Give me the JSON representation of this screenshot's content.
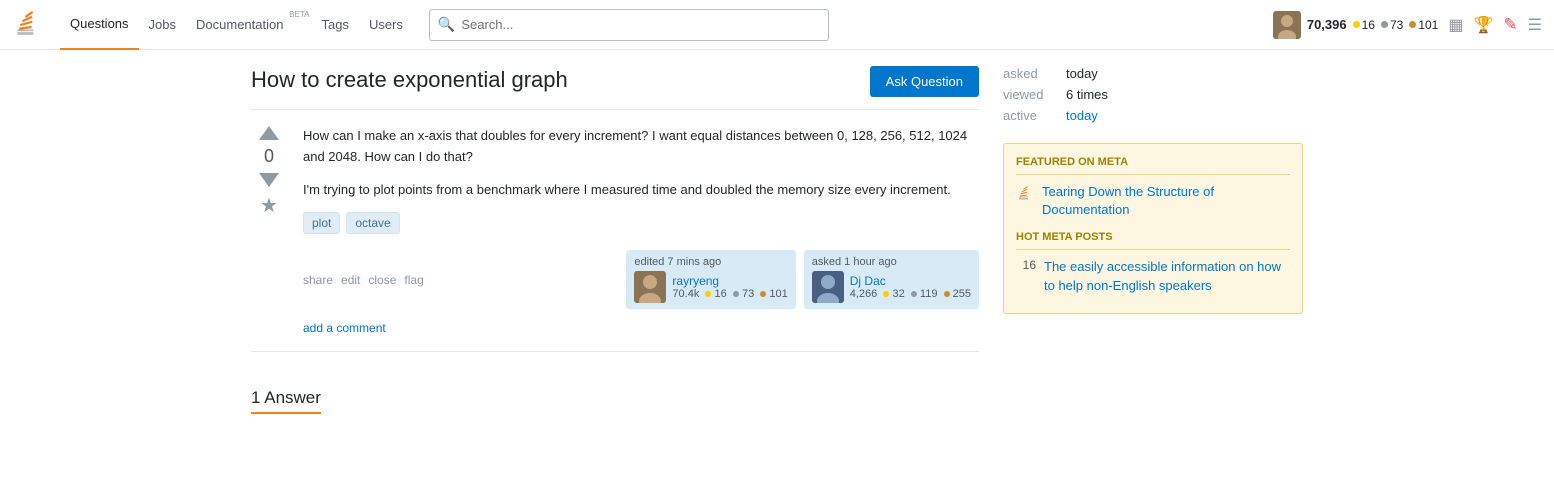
{
  "header": {
    "nav_items": [
      {
        "label": "Questions",
        "active": true,
        "beta": false
      },
      {
        "label": "Jobs",
        "active": false,
        "beta": false
      },
      {
        "label": "Documentation",
        "active": false,
        "beta": true
      },
      {
        "label": "Tags",
        "active": false,
        "beta": false
      },
      {
        "label": "Users",
        "active": false,
        "beta": false
      }
    ],
    "search_placeholder": "Search...",
    "user_rep": "70,396",
    "badge_gold": "16",
    "badge_silver": "73",
    "badge_bronze": "101"
  },
  "question": {
    "title": "How to create exponential graph",
    "ask_button": "Ask Question",
    "body_p1": "How can I make an x-axis that doubles for every increment? I want equal distances between 0, 128, 256, 512, 1024 and 2048. How can I do that?",
    "body_p2": "I'm trying to plot points from a benchmark where I measured time and doubled the memory size every increment.",
    "vote_count": "0",
    "tags": [
      "plot",
      "octave"
    ],
    "actions": [
      "share",
      "edit",
      "close",
      "flag"
    ],
    "edited_label": "edited 7 mins ago",
    "editor_name": "rayryeng",
    "editor_rep": "70.4k",
    "editor_gold": "16",
    "editor_silver": "73",
    "editor_bronze": "101",
    "asked_label": "asked 1 hour ago",
    "asker_name": "Dj Dac",
    "asker_rep": "4,266",
    "asker_gold": "32",
    "asker_silver": "119",
    "asker_bronze": "255",
    "add_comment": "add a comment"
  },
  "meta": {
    "asked_label": "asked",
    "asked_value": "today",
    "viewed_label": "viewed",
    "viewed_value": "6 times",
    "active_label": "active",
    "active_value": "today"
  },
  "sidebar": {
    "featured_title": "FEATURED ON META",
    "featured_items": [
      {
        "text": "Tearing Down the Structure of Documentation"
      }
    ],
    "hot_meta_title": "HOT META POSTS",
    "hot_meta_items": [
      {
        "num": "16",
        "text": "The easily accessible information on how to help non-English speakers"
      }
    ]
  },
  "answers": {
    "count_label": "1 Answer"
  }
}
